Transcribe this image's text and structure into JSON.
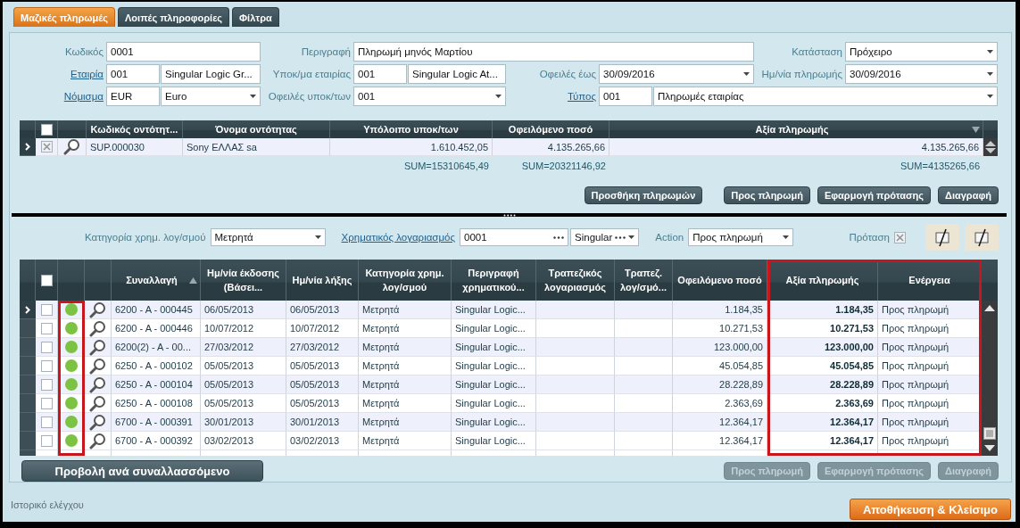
{
  "tabs": [
    {
      "label": "Μαζικές πληρωμές",
      "selected": true
    },
    {
      "label": "Λοιπές πληροφορίες",
      "selected": false
    },
    {
      "label": "Φίλτρα",
      "selected": false
    }
  ],
  "header_form": {
    "fields": [
      {
        "label": "Κωδικός",
        "link": false,
        "kind": "text",
        "value": "0001"
      },
      {
        "label": "Περιγραφή",
        "link": false,
        "kind": "text",
        "value": "Πληρωμή μηνός Μαρτίου"
      },
      {
        "label": "Κατάσταση",
        "link": false,
        "kind": "dropdown",
        "value": "Πρόχειρο"
      },
      {
        "label": "Εταιρία",
        "link": true,
        "kind": "code_dropdown",
        "code": "001",
        "value": "Singular Logic Gr..."
      },
      {
        "label": "Υποκ/μα εταιρίας",
        "link": false,
        "kind": "code_dropdown",
        "code": "001",
        "value": "Singular Logic At..."
      },
      {
        "label": "Οφειλές έως",
        "link": false,
        "kind": "dropdown",
        "value": "30/09/2016"
      },
      {
        "label": "Ημ/νία πληρωμής",
        "link": false,
        "kind": "dropdown",
        "value": "30/09/2016"
      },
      {
        "label": "Νόμισμα",
        "link": true,
        "kind": "code_dropdown",
        "code": "EUR",
        "value": "Euro"
      },
      {
        "label": "Οφειλές υποκ/των",
        "link": false,
        "kind": "dropdown",
        "value": "001"
      },
      {
        "label": "Τύπος",
        "link": true,
        "kind": "code_dropdown",
        "code": "001",
        "value": "Πληρωμές εταιρίας"
      }
    ]
  },
  "entities_table": {
    "select_all": {
      "checked": false
    },
    "columns": [
      {
        "kind": "text",
        "title": "Κωδικός οντότητ..."
      },
      {
        "kind": "text",
        "title": "Όνομα οντότητας"
      },
      {
        "kind": "number",
        "title": "Υπόλοιπο υποκ/των",
        "sum": "SUM=15310645,49"
      },
      {
        "kind": "number",
        "title": "Οφειλόμενο ποσό",
        "sum": "SUM=20321146,92"
      },
      {
        "kind": "number",
        "title": "Αξία πληρωμής",
        "sorted": true,
        "descending": true,
        "sum": "SUM=4135265,66"
      }
    ],
    "rows": [
      {
        "selected": true,
        "checked": true,
        "cells": [
          "SUP.000030",
          "Sony ΕΛΛΑΣ sa",
          "1.610.452,05",
          "4.135.265,66",
          "4.135.265,66"
        ]
      }
    ]
  },
  "entity_buttons": [
    {
      "label": "Προσθήκη πληρωμών",
      "disabled": false
    },
    {
      "label": "Προς πληρωμή",
      "disabled": false
    },
    {
      "label": "Εφαρμογή πρότασης",
      "disabled": false
    },
    {
      "label": "Διαγραφή",
      "disabled": false
    }
  ],
  "filter_bar": {
    "fields": [
      {
        "kind": "dropdown",
        "label": "Κατηγορία χρημ. λογ/σμού",
        "link": false,
        "value": "Μετρητά"
      },
      {
        "kind": "lookup",
        "label": "Χρηματικός λογαριασμός",
        "link": true,
        "code": "0001",
        "value": "Singular"
      },
      {
        "kind": "dropdown",
        "label": "Action",
        "link": false,
        "value": "Προς πληρωμή"
      },
      {
        "kind": "checkbox",
        "label": "Πρόταση",
        "link": false,
        "checked": true
      }
    ]
  },
  "transactions_table": {
    "select_all": {
      "checked": false
    },
    "status_column_highlighted": true,
    "columns": [
      {
        "kind": "text",
        "title": "Συναλλαγή",
        "sorted": true,
        "descending": false
      },
      {
        "kind": "text",
        "title": "Ημ/νία έκδοσης (Βάσει..."
      },
      {
        "kind": "text",
        "title": "Ημ/νία λήξης"
      },
      {
        "kind": "text",
        "title": "Κατηγορία χρημ. λογ/σμού"
      },
      {
        "kind": "text",
        "title": "Περιγραφή χρηματικού..."
      },
      {
        "kind": "text",
        "title": "Τραπεζικός λογαριασμός"
      },
      {
        "kind": "text",
        "title": "Τραπεζ. λογ/σμό..."
      },
      {
        "kind": "number",
        "title": "Οφειλόμενο ποσό"
      },
      {
        "kind": "amount",
        "title": "Αξία πληρωμής",
        "highlighted": true
      },
      {
        "kind": "text",
        "title": "Ενέργεια",
        "highlighted": true
      }
    ],
    "rows": [
      {
        "selected": true,
        "checked": false,
        "color": "#7cc243",
        "cells": [
          "6200 - A - 000445",
          "06/05/2013",
          "06/05/2013",
          "Μετρητά",
          "Singular Logic...",
          null,
          null,
          "1.184,35",
          "1.184,35",
          "Προς πληρωμή"
        ]
      },
      {
        "selected": false,
        "checked": false,
        "color": "#7cc243",
        "cells": [
          "6200 - A - 000446",
          "10/07/2012",
          "10/07/2012",
          "Μετρητά",
          "Singular Logic...",
          null,
          null,
          "10.271,53",
          "10.271,53",
          "Προς πληρωμή"
        ]
      },
      {
        "selected": false,
        "checked": false,
        "color": "#7cc243",
        "cells": [
          "6200(2) - A - 00...",
          "27/03/2012",
          "27/03/2012",
          "Μετρητά",
          "Singular Logic...",
          null,
          null,
          "123.000,00",
          "123.000,00",
          "Προς πληρωμή"
        ]
      },
      {
        "selected": false,
        "checked": false,
        "color": "#7cc243",
        "cells": [
          "6250 - A - 000102",
          "05/05/2013",
          "05/05/2013",
          "Μετρητά",
          "Singular Logic...",
          null,
          null,
          "45.054,85",
          "45.054,85",
          "Προς πληρωμή"
        ]
      },
      {
        "selected": false,
        "checked": false,
        "color": "#7cc243",
        "cells": [
          "6250 - A - 000104",
          "05/05/2013",
          "05/05/2013",
          "Μετρητά",
          "Singular Logic...",
          null,
          null,
          "28.228,89",
          "28.228,89",
          "Προς πληρωμή"
        ]
      },
      {
        "selected": false,
        "checked": false,
        "color": "#7cc243",
        "cells": [
          "6250 - A - 000108",
          "05/05/2013",
          "05/05/2013",
          "Μετρητά",
          "Singular Logic...",
          null,
          null,
          "2.363,69",
          "2.363,69",
          "Προς πληρωμή"
        ]
      },
      {
        "selected": false,
        "checked": false,
        "color": "#7cc243",
        "cells": [
          "6700 - A - 000391",
          "30/01/2013",
          "30/01/2013",
          "Μετρητά",
          "Singular Logic...",
          null,
          null,
          "12.364,17",
          "12.364,17",
          "Προς πληρωμή"
        ]
      },
      {
        "selected": false,
        "checked": false,
        "color": "#7cc243",
        "cells": [
          "6700 - A - 000392",
          "03/02/2013",
          "03/02/2013",
          "Μετρητά",
          "Singular Logic...",
          null,
          null,
          "12.364,17",
          "12.364,17",
          "Προς πληρωμή"
        ]
      }
    ]
  },
  "view_button": {
    "label": "Προβολή ανά συναλλασσόμενο",
    "disabled": false
  },
  "transaction_buttons": [
    {
      "label": "Προς πληρωμή",
      "disabled": true
    },
    {
      "label": "Εφαρμογή πρότασης",
      "disabled": true
    },
    {
      "label": "Διαγραφή",
      "disabled": true
    }
  ],
  "footer": {
    "audit_link": "Ιστορικό ελέγχου",
    "save_button": "Αποθήκευση & Κλείσιμο"
  }
}
